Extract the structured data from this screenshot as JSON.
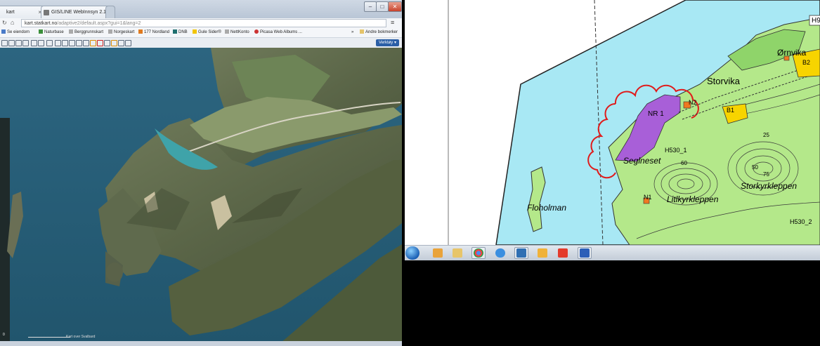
{
  "browser": {
    "tabs": [
      {
        "label": "kart"
      },
      {
        "label": "GIS/LINE WebInnsyn 2.1.8"
      }
    ],
    "window_buttons": {
      "minimize": "–",
      "maximize": "□",
      "close": "✕"
    },
    "address": {
      "host": "kart.statkart.no",
      "path": "/adaptive2/default.aspx?gui=1&lang=2"
    },
    "bookmarks": [
      "Se eiendom",
      "Naturbase",
      "Berggrunnskart",
      "Norgeskart",
      "177 Nordland",
      "DNB",
      "Gule Sider®",
      "NettKonto",
      "Picasa Web Albums ...",
      "»",
      "Andre bokmerker"
    ],
    "verktoy_label": "Verktøy",
    "scale_label": "Kart over Svalbard",
    "scale_left": "0"
  },
  "plan": {
    "labels": {
      "h9": "H9",
      "ornvika": "Ørnvika",
      "b2": "B2",
      "storvika": "Storvika",
      "nr1": "NR 1",
      "n2": "N2",
      "b1": "B1",
      "h530_1": "H530_1",
      "seglneset": "Seglneset",
      "floholman": "Floholman",
      "n1": "N1",
      "litlkyrkleppen": "Litlkyrkleppen",
      "storkyrkleppen": "Storkyrkleppen",
      "h530_2": "H530_2",
      "c50": "50",
      "c75": "75",
      "c60": "60",
      "c25": "25"
    }
  },
  "taskbar": {
    "icons": [
      "media-player-icon",
      "file-explorer-icon",
      "chrome-icon",
      "internet-explorer-icon",
      "gis-app-icon",
      "outlook-icon",
      "pdf-reader-icon",
      "word-icon"
    ]
  }
}
